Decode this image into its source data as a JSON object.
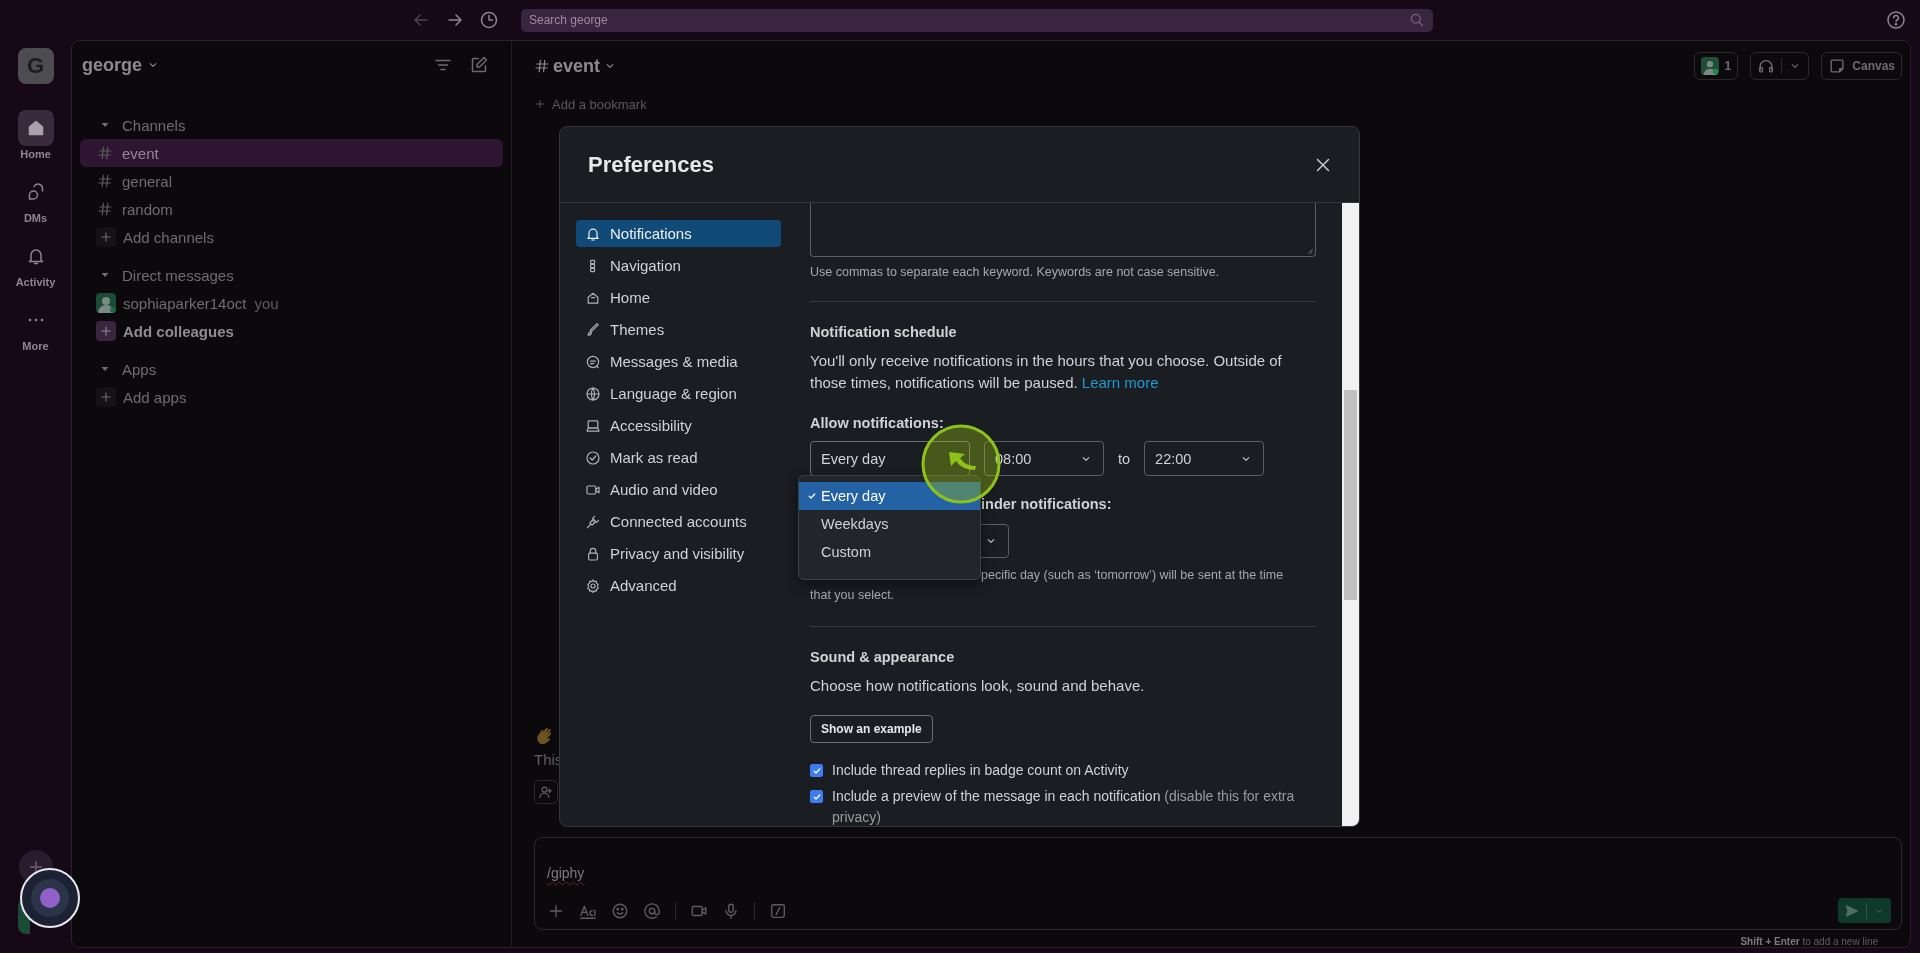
{
  "top_bar": {
    "search": {
      "placeholder": "Search george"
    }
  },
  "rail": {
    "workspace_initial": "G",
    "items": [
      {
        "label": "Home",
        "selected": true
      },
      {
        "label": "DMs",
        "selected": false
      },
      {
        "label": "Activity",
        "selected": false
      },
      {
        "label": "More",
        "selected": false
      }
    ]
  },
  "sidebar": {
    "workspace": "george",
    "sections": [
      {
        "title": "Channels",
        "expanded": true,
        "items": [
          {
            "kind": "channel",
            "label": "event",
            "selected": true
          },
          {
            "kind": "channel",
            "label": "general",
            "selected": false
          },
          {
            "kind": "channel",
            "label": "random",
            "selected": false
          },
          {
            "kind": "add",
            "label": "Add channels",
            "selected": false
          }
        ]
      },
      {
        "title": "Direct messages",
        "expanded": true,
        "items": [
          {
            "kind": "person",
            "label": "sophiaparker14oct",
            "suffix": "you",
            "selected": false
          },
          {
            "kind": "add_strong",
            "label": "Add colleagues",
            "selected": false
          }
        ]
      },
      {
        "title": "Apps",
        "expanded": true,
        "items": [
          {
            "kind": "add",
            "label": "Add apps",
            "selected": false
          }
        ]
      }
    ]
  },
  "channel_header": {
    "name": "event",
    "members": "1",
    "canvas": "Canvas",
    "bookmark": "Add a bookmark"
  },
  "messages": {
    "intro": "This"
  },
  "composer": {
    "value": "/giphy",
    "hint": "**Shift + Enter** to add a new line"
  },
  "preferences": {
    "title": "Preferences",
    "nav": [
      {
        "label": "Notifications",
        "selected": true
      },
      {
        "label": "Navigation",
        "selected": false
      },
      {
        "label": "Home",
        "selected": false
      },
      {
        "label": "Themes",
        "selected": false
      },
      {
        "label": "Messages & media",
        "selected": false
      },
      {
        "label": "Language & region",
        "selected": false
      },
      {
        "label": "Accessibility",
        "selected": false
      },
      {
        "label": "Mark as read",
        "selected": false
      },
      {
        "label": "Audio and video",
        "selected": false
      },
      {
        "label": "Connected accounts",
        "selected": false
      },
      {
        "label": "Privacy and visibility",
        "selected": false
      },
      {
        "label": "Advanced",
        "selected": false
      }
    ],
    "keywords_help": "Use commas to separate each keyword. Keywords are not case sensitive.",
    "schedule": {
      "title": "Notification schedule",
      "text": "You'll only receive notifications in the hours that you choose. Outside of those times, notifications will be paused.",
      "link": "Learn more",
      "allow_label": "Allow notifications:",
      "days": {
        "value": "Every day",
        "expanded": true,
        "options": [
          {
            "label": "Every day",
            "selected": true
          },
          {
            "label": "Weekdays",
            "selected": false
          },
          {
            "label": "Custom",
            "selected": false
          }
        ]
      },
      "from": "08:00",
      "to_label": "to",
      "to": "22:00",
      "reminder_label": "inder notifications:",
      "reminder_help": [
        "pecific day (such as ‘tomorrow’) will be sent at the time",
        "that you select."
      ]
    },
    "sound": {
      "title": "Sound & appearance",
      "text": "Choose how notifications look, sound and behave.",
      "button": "Show an example",
      "options": [
        {
          "label": "Include thread replies in badge count on Activity",
          "checked": true
        },
        {
          "label": "Include a preview of the message in each notification",
          "note": "(disable this for extra privacy)",
          "checked": true
        }
      ]
    }
  }
}
